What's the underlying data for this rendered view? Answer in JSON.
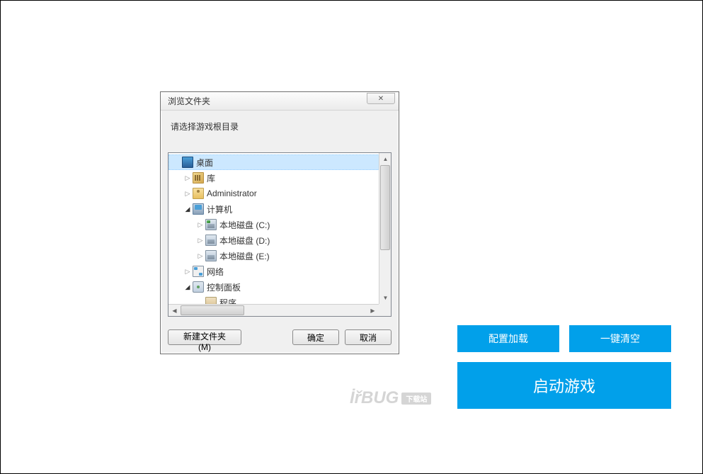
{
  "dialog": {
    "title": "浏览文件夹",
    "prompt": "请选择游戏根目录",
    "tree": {
      "desktop": "桌面",
      "library": "库",
      "administrator": "Administrator",
      "computer": "计算机",
      "disk_c": "本地磁盘 (C:)",
      "disk_d": "本地磁盘 (D:)",
      "disk_e": "本地磁盘 (E:)",
      "network": "网络",
      "control_panel": "控制面板",
      "programs": "程序"
    },
    "buttons": {
      "new_folder": "新建文件夹 (M)",
      "ok": "确定",
      "cancel": "取消"
    },
    "close_symbol": "✕"
  },
  "right": {
    "config_load": "配置加载",
    "clear_all": "一键清空",
    "launch_game": "启动游戏"
  },
  "watermark": {
    "text": "İřBUG",
    "badge": "下载站"
  }
}
